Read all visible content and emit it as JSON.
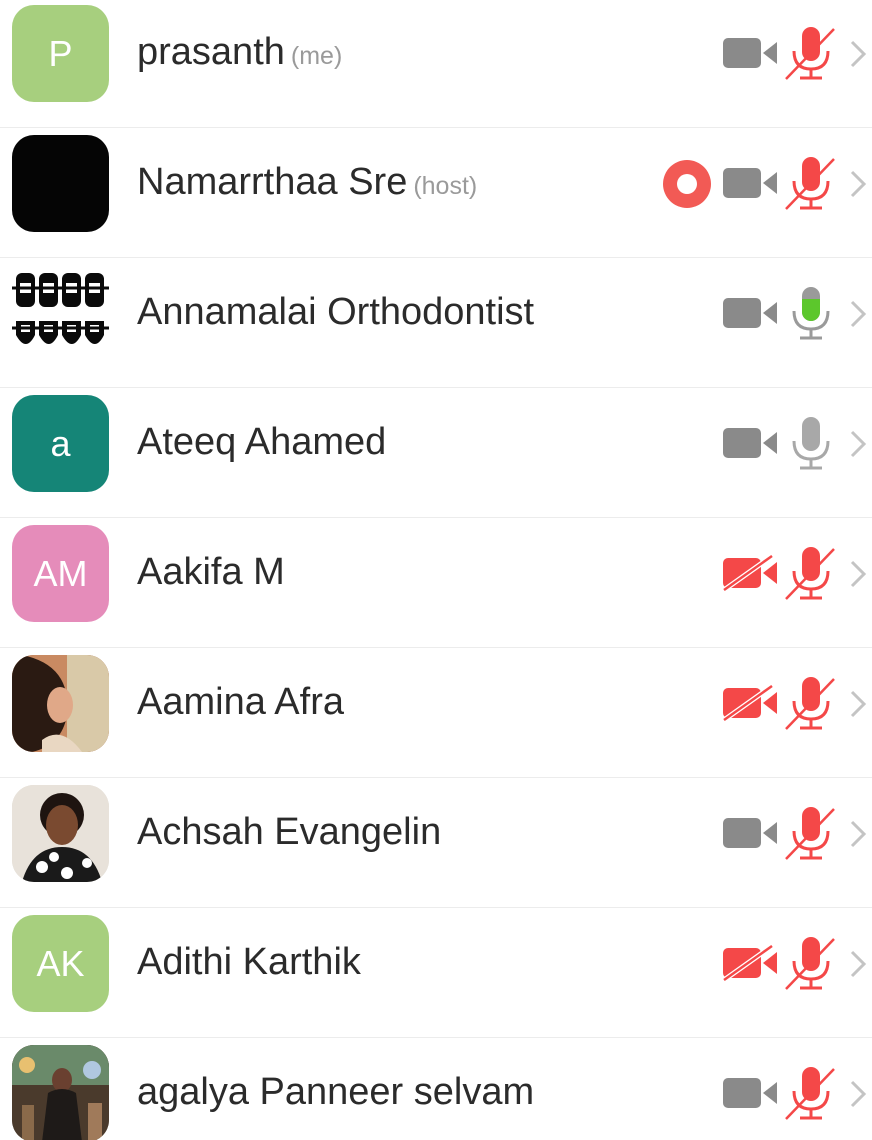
{
  "participants": [
    {
      "name": "prasanth",
      "tag": "(me)",
      "avatar_initials": "P",
      "avatar_color": "#a7cf7e",
      "avatar_kind": "initials",
      "video": "on",
      "mic": "muted",
      "recording": false
    },
    {
      "name": "Namarrthaa Sre",
      "tag": "(host)",
      "avatar_initials": "",
      "avatar_color": "#050505",
      "avatar_kind": "solid",
      "video": "on",
      "mic": "muted",
      "recording": true
    },
    {
      "name": "Annamalai Orthodontist",
      "tag": "",
      "avatar_initials": "",
      "avatar_color": "#ffffff",
      "avatar_kind": "braces",
      "video": "on",
      "mic": "speaking",
      "recording": false
    },
    {
      "name": "Ateeq Ahamed",
      "tag": "",
      "avatar_initials": "a",
      "avatar_color": "#158577",
      "avatar_kind": "initials",
      "video": "on",
      "mic": "on",
      "recording": false
    },
    {
      "name": "Aakifa M",
      "tag": "",
      "avatar_initials": "AM",
      "avatar_color": "#e58cba",
      "avatar_kind": "initials",
      "video": "off",
      "mic": "muted",
      "recording": false
    },
    {
      "name": "Aamina Afra",
      "tag": "",
      "avatar_initials": "",
      "avatar_color": "#8a5a3c",
      "avatar_kind": "photo-portrait",
      "video": "off",
      "mic": "muted",
      "recording": false
    },
    {
      "name": "Achsah Evangelin",
      "tag": "",
      "avatar_initials": "",
      "avatar_color": "#d9d2c8",
      "avatar_kind": "photo-girl",
      "video": "on",
      "mic": "muted",
      "recording": false
    },
    {
      "name": "Adithi Karthik",
      "tag": "",
      "avatar_initials": "AK",
      "avatar_color": "#a7cf7e",
      "avatar_kind": "initials",
      "video": "off",
      "mic": "muted",
      "recording": false
    },
    {
      "name": "agalya Panneer selvam",
      "tag": "",
      "avatar_initials": "",
      "avatar_color": "#5a4a3a",
      "avatar_kind": "photo-crowd",
      "video": "on",
      "mic": "muted",
      "recording": false
    }
  ],
  "icons": {
    "video_on": "video-camera-icon",
    "video_off": "video-off-icon",
    "mic_muted": "microphone-muted-icon",
    "mic_on": "microphone-icon",
    "mic_speaking": "microphone-active-icon",
    "recording": "recording-icon",
    "chevron": "chevron-right-icon"
  },
  "colors": {
    "icon_gray": "#8a8a8a",
    "mic_gray": "#a8a8a8",
    "muted_red": "#f44848",
    "speaking_green": "#5cc72c",
    "record_red": "#f25a55"
  }
}
